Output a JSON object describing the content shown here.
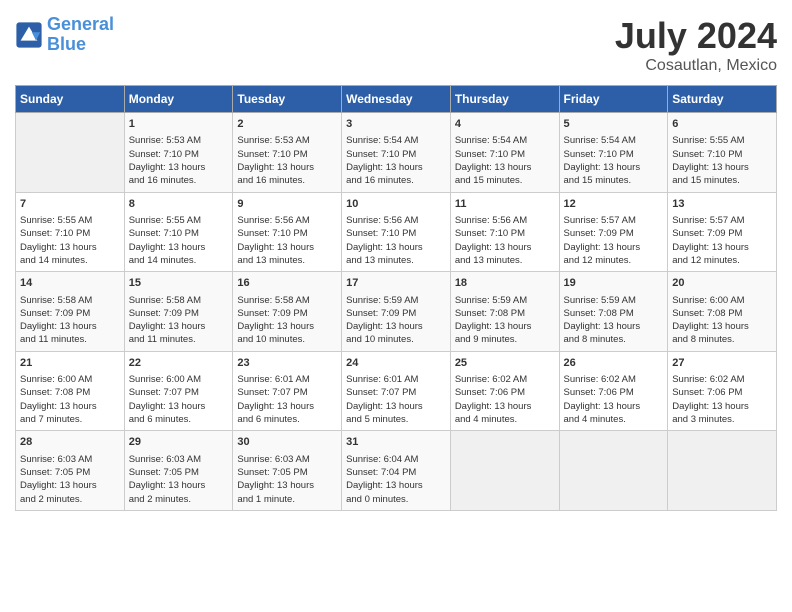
{
  "header": {
    "logo_line1": "General",
    "logo_line2": "Blue",
    "month_title": "July 2024",
    "subtitle": "Cosautlan, Mexico"
  },
  "weekdays": [
    "Sunday",
    "Monday",
    "Tuesday",
    "Wednesday",
    "Thursday",
    "Friday",
    "Saturday"
  ],
  "weeks": [
    [
      {
        "day": "",
        "info": ""
      },
      {
        "day": "1",
        "info": "Sunrise: 5:53 AM\nSunset: 7:10 PM\nDaylight: 13 hours\nand 16 minutes."
      },
      {
        "day": "2",
        "info": "Sunrise: 5:53 AM\nSunset: 7:10 PM\nDaylight: 13 hours\nand 16 minutes."
      },
      {
        "day": "3",
        "info": "Sunrise: 5:54 AM\nSunset: 7:10 PM\nDaylight: 13 hours\nand 16 minutes."
      },
      {
        "day": "4",
        "info": "Sunrise: 5:54 AM\nSunset: 7:10 PM\nDaylight: 13 hours\nand 15 minutes."
      },
      {
        "day": "5",
        "info": "Sunrise: 5:54 AM\nSunset: 7:10 PM\nDaylight: 13 hours\nand 15 minutes."
      },
      {
        "day": "6",
        "info": "Sunrise: 5:55 AM\nSunset: 7:10 PM\nDaylight: 13 hours\nand 15 minutes."
      }
    ],
    [
      {
        "day": "7",
        "info": "Sunrise: 5:55 AM\nSunset: 7:10 PM\nDaylight: 13 hours\nand 14 minutes."
      },
      {
        "day": "8",
        "info": "Sunrise: 5:55 AM\nSunset: 7:10 PM\nDaylight: 13 hours\nand 14 minutes."
      },
      {
        "day": "9",
        "info": "Sunrise: 5:56 AM\nSunset: 7:10 PM\nDaylight: 13 hours\nand 13 minutes."
      },
      {
        "day": "10",
        "info": "Sunrise: 5:56 AM\nSunset: 7:10 PM\nDaylight: 13 hours\nand 13 minutes."
      },
      {
        "day": "11",
        "info": "Sunrise: 5:56 AM\nSunset: 7:10 PM\nDaylight: 13 hours\nand 13 minutes."
      },
      {
        "day": "12",
        "info": "Sunrise: 5:57 AM\nSunset: 7:09 PM\nDaylight: 13 hours\nand 12 minutes."
      },
      {
        "day": "13",
        "info": "Sunrise: 5:57 AM\nSunset: 7:09 PM\nDaylight: 13 hours\nand 12 minutes."
      }
    ],
    [
      {
        "day": "14",
        "info": "Sunrise: 5:58 AM\nSunset: 7:09 PM\nDaylight: 13 hours\nand 11 minutes."
      },
      {
        "day": "15",
        "info": "Sunrise: 5:58 AM\nSunset: 7:09 PM\nDaylight: 13 hours\nand 11 minutes."
      },
      {
        "day": "16",
        "info": "Sunrise: 5:58 AM\nSunset: 7:09 PM\nDaylight: 13 hours\nand 10 minutes."
      },
      {
        "day": "17",
        "info": "Sunrise: 5:59 AM\nSunset: 7:09 PM\nDaylight: 13 hours\nand 10 minutes."
      },
      {
        "day": "18",
        "info": "Sunrise: 5:59 AM\nSunset: 7:08 PM\nDaylight: 13 hours\nand 9 minutes."
      },
      {
        "day": "19",
        "info": "Sunrise: 5:59 AM\nSunset: 7:08 PM\nDaylight: 13 hours\nand 8 minutes."
      },
      {
        "day": "20",
        "info": "Sunrise: 6:00 AM\nSunset: 7:08 PM\nDaylight: 13 hours\nand 8 minutes."
      }
    ],
    [
      {
        "day": "21",
        "info": "Sunrise: 6:00 AM\nSunset: 7:08 PM\nDaylight: 13 hours\nand 7 minutes."
      },
      {
        "day": "22",
        "info": "Sunrise: 6:00 AM\nSunset: 7:07 PM\nDaylight: 13 hours\nand 6 minutes."
      },
      {
        "day": "23",
        "info": "Sunrise: 6:01 AM\nSunset: 7:07 PM\nDaylight: 13 hours\nand 6 minutes."
      },
      {
        "day": "24",
        "info": "Sunrise: 6:01 AM\nSunset: 7:07 PM\nDaylight: 13 hours\nand 5 minutes."
      },
      {
        "day": "25",
        "info": "Sunrise: 6:02 AM\nSunset: 7:06 PM\nDaylight: 13 hours\nand 4 minutes."
      },
      {
        "day": "26",
        "info": "Sunrise: 6:02 AM\nSunset: 7:06 PM\nDaylight: 13 hours\nand 4 minutes."
      },
      {
        "day": "27",
        "info": "Sunrise: 6:02 AM\nSunset: 7:06 PM\nDaylight: 13 hours\nand 3 minutes."
      }
    ],
    [
      {
        "day": "28",
        "info": "Sunrise: 6:03 AM\nSunset: 7:05 PM\nDaylight: 13 hours\nand 2 minutes."
      },
      {
        "day": "29",
        "info": "Sunrise: 6:03 AM\nSunset: 7:05 PM\nDaylight: 13 hours\nand 2 minutes."
      },
      {
        "day": "30",
        "info": "Sunrise: 6:03 AM\nSunset: 7:05 PM\nDaylight: 13 hours\nand 1 minute."
      },
      {
        "day": "31",
        "info": "Sunrise: 6:04 AM\nSunset: 7:04 PM\nDaylight: 13 hours\nand 0 minutes."
      },
      {
        "day": "",
        "info": ""
      },
      {
        "day": "",
        "info": ""
      },
      {
        "day": "",
        "info": ""
      }
    ]
  ]
}
